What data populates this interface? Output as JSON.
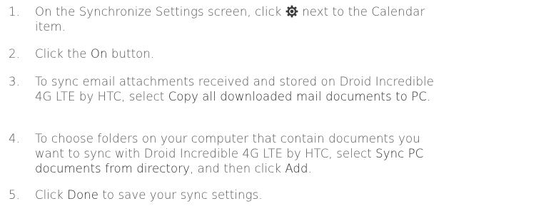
{
  "steps": [
    {
      "number": "1.",
      "line1_before": "On the Synchronize Settings screen, click",
      "line1_after": "next to the Calendar",
      "line2": "item.",
      "icon": "gear-icon"
    },
    {
      "number": "2.",
      "before": "Click the ",
      "bold": "On",
      "after": " button."
    },
    {
      "number": "3.",
      "line1": "To sync email attachments received and stored on Droid Incredible",
      "line2_before": "4G LTE by HTC, select ",
      "line2_bold": "Copy all downloaded mail documents to PC",
      "line2_after": "."
    },
    {
      "number": "4.",
      "line1": "To choose folders on your computer that contain documents you",
      "line2_before": "want to sync with Droid Incredible 4G LTE by HTC, select ",
      "line2_bold": "Sync PC",
      "line3_bold": "documents from directory",
      "line3_mid": ", and then click ",
      "line3_bold2": "Add",
      "line3_after": "."
    },
    {
      "number": "5.",
      "before": "Click ",
      "bold": "Done",
      "after": " to save your sync settings."
    }
  ],
  "colors": {
    "text": "#555555",
    "emphasis": "#2a2a2a",
    "icon": "#3a3a3a"
  }
}
